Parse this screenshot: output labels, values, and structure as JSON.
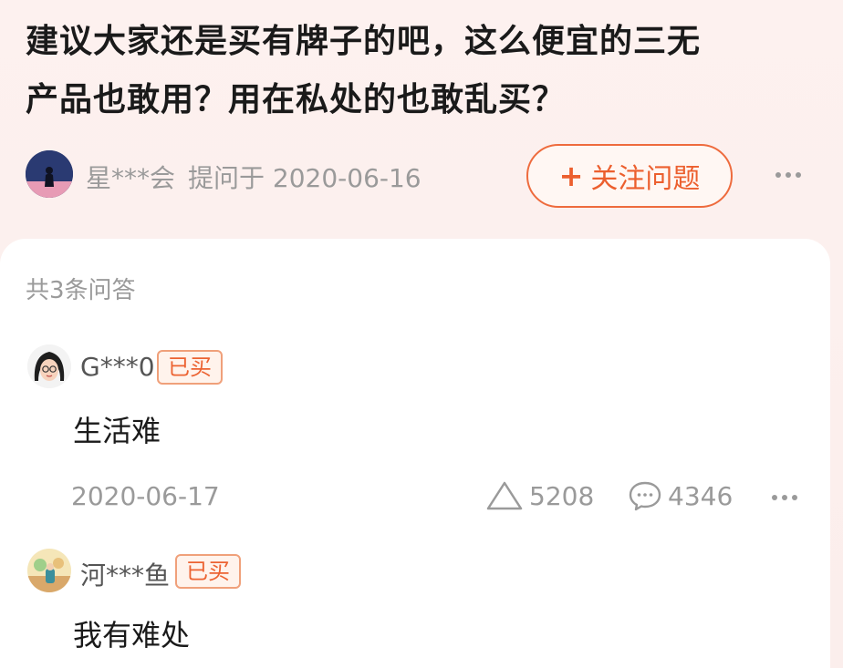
{
  "question": {
    "title_line1": "建议大家还是买有牌子的吧，这么便宜的三无",
    "title_line2": "产品也敢用？用在私处的也敢乱买？",
    "asker_name": "星***会",
    "asked_meta": "提问于 2020-06-16",
    "follow_button": {
      "plus": "+",
      "label": "关注问题"
    }
  },
  "answers_summary": {
    "count_label": "共3条问答"
  },
  "answers": [
    {
      "user": "G***0",
      "badge": "已买",
      "text": "生活难",
      "date": "2020-06-17",
      "likes": "5208",
      "comments": "4346"
    },
    {
      "user": "河***鱼",
      "badge": "已买",
      "text": "我有难处"
    }
  ],
  "colors": {
    "accent": "#ec5f2e",
    "header_bg": "#fbeeec",
    "muted_text": "#9a9a9a"
  }
}
